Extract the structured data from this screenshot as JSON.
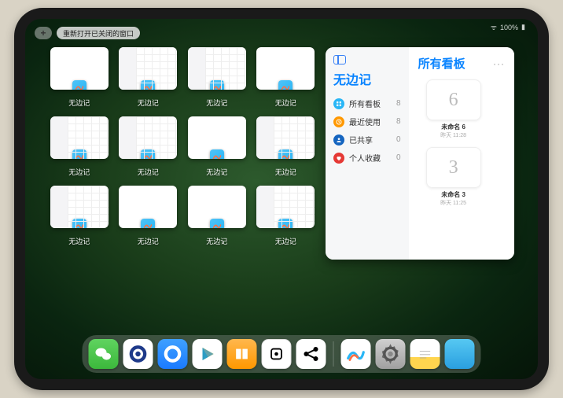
{
  "status": {
    "battery": "100%",
    "wifi": "●●●"
  },
  "top": {
    "new_tab_glyph": "+",
    "reopen_label": "重新打开已关闭的窗口"
  },
  "app_name": "无边记",
  "windows": [
    {
      "label": "无边记",
      "style": "blank"
    },
    {
      "label": "无边记",
      "style": "grid"
    },
    {
      "label": "无边记",
      "style": "grid"
    },
    {
      "label": "无边记",
      "style": "blank"
    },
    {
      "label": "无边记",
      "style": "grid"
    },
    {
      "label": "无边记",
      "style": "grid"
    },
    {
      "label": "无边记",
      "style": "blank"
    },
    {
      "label": "无边记",
      "style": "grid"
    },
    {
      "label": "无边记",
      "style": "grid"
    },
    {
      "label": "无边记",
      "style": "blank"
    },
    {
      "label": "无边记",
      "style": "blank"
    },
    {
      "label": "无边记",
      "style": "grid"
    }
  ],
  "panel": {
    "left_title": "无边记",
    "items": [
      {
        "label": "所有看板",
        "count": "8",
        "color": "#29b6f6",
        "icon": "grid"
      },
      {
        "label": "最近使用",
        "count": "8",
        "color": "#ff9800",
        "icon": "clock"
      },
      {
        "label": "已共享",
        "count": "0",
        "color": "#1565c0",
        "icon": "person"
      },
      {
        "label": "个人收藏",
        "count": "0",
        "color": "#e53935",
        "icon": "heart"
      }
    ],
    "right_title": "所有看板",
    "more": "···",
    "boards": [
      {
        "glyph": "6",
        "name": "未命名 6",
        "sub": "昨天 11:28"
      },
      {
        "glyph": "3",
        "name": "未命名 3",
        "sub": "昨天 11:25"
      }
    ]
  },
  "dock": {
    "apps": [
      {
        "name": "wechat"
      },
      {
        "name": "quark-white"
      },
      {
        "name": "quark-blue"
      },
      {
        "name": "play"
      },
      {
        "name": "books"
      },
      {
        "name": "dice"
      },
      {
        "name": "connect"
      }
    ],
    "recent": [
      {
        "name": "freeform"
      },
      {
        "name": "settings"
      },
      {
        "name": "notes"
      },
      {
        "name": "app-library"
      }
    ]
  }
}
